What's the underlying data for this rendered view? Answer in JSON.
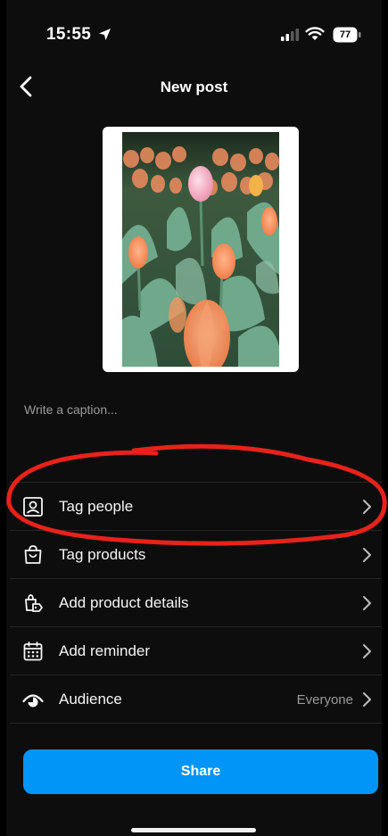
{
  "status_bar": {
    "time": "15:55",
    "battery": "77"
  },
  "header": {
    "title": "New post"
  },
  "caption": {
    "placeholder": "Write a caption..."
  },
  "menu": [
    {
      "label": "Tag people",
      "icon": "tag-people-icon"
    },
    {
      "label": "Tag products",
      "icon": "shopping-bag-icon"
    },
    {
      "label": "Add product details",
      "icon": "product-tag-icon"
    },
    {
      "label": "Add reminder",
      "icon": "calendar-icon"
    },
    {
      "label": "Audience",
      "icon": "audience-icon",
      "value": "Everyone"
    }
  ],
  "share": {
    "label": "Share"
  },
  "colors": {
    "accent": "#0095f6",
    "annotation": "#e8221b",
    "background": "#0d0d0d"
  }
}
